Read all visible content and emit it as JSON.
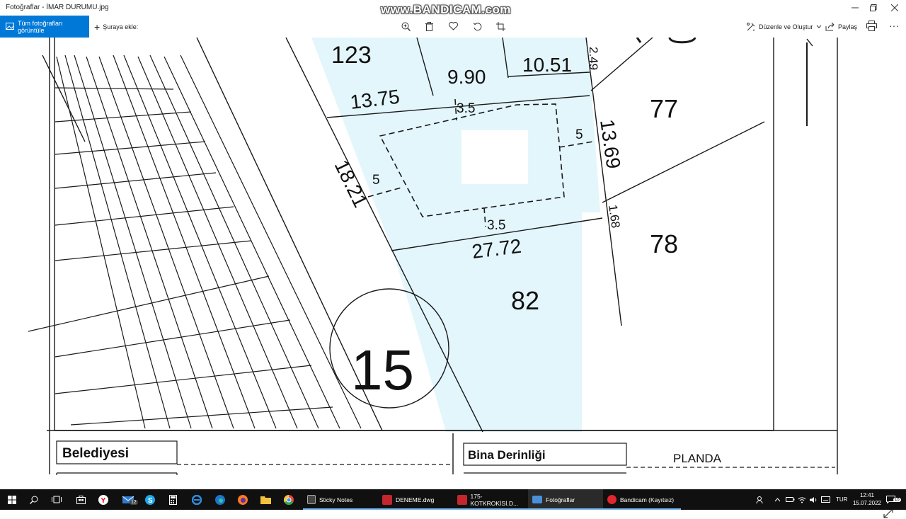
{
  "window": {
    "title": "Fotoğraflar - İMAR DURUMU.jpg",
    "watermark": "www.BANDICAM.com",
    "controls": [
      "minimize",
      "maximize",
      "close"
    ]
  },
  "toolbar": {
    "all_photos_label": "Tüm fotoğrafları görüntüle",
    "add_to_label": "Şuraya ekle:",
    "edit_create_label": "Düzenle ve Oluştur",
    "share_label": "Paylaş",
    "icons": [
      "zoom-in-icon",
      "delete-icon",
      "favorite-icon",
      "rotate-icon",
      "crop-icon"
    ]
  },
  "plan": {
    "parcel_labels": {
      "p123": "123",
      "p77": "77",
      "p78": "78",
      "p82": "82",
      "block": "15"
    },
    "dimensions": {
      "d1375": "13.75",
      "d990": "9.90",
      "d1051": "10.51",
      "d249": "2.49",
      "d35_top": "3.5",
      "d5_right": "5",
      "d1369": "13.69",
      "d1821": "18.21",
      "d5_left": "5",
      "d168": "1.68",
      "d35_bottom": "3.5",
      "d2772": "27.72"
    },
    "footer": {
      "belediyesi": "Belediyesi",
      "bina_derinligi": "Bina Derinliği",
      "planda": "PLANDA"
    },
    "colors": {
      "highlight": "#e3f6fc",
      "ink": "#1a1a1a"
    }
  },
  "taskbar": {
    "apps": [
      {
        "label": "Sticky Notes",
        "color": "#f7d13a"
      },
      {
        "label": "DENEME.dwg",
        "color": "#c4262e"
      },
      {
        "label": "175-KOTKROKİSİ.D...",
        "color": "#c4262e"
      },
      {
        "label": "Fotoğraflar",
        "color": "#4a90d9"
      },
      {
        "label": "Bandicam (Kayıtsız)",
        "color": "#e0262e"
      }
    ],
    "mail_badge": "12",
    "language": "TUR",
    "time": "12:41",
    "date": "15.07.2022",
    "notification_count": "16"
  }
}
